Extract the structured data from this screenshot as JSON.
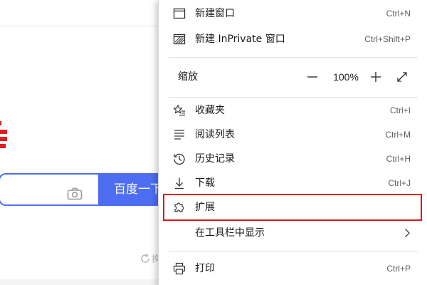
{
  "background": {
    "search_button_label": "百度一下",
    "refresh_text": "换"
  },
  "menu": {
    "items": [
      {
        "id": "new-window",
        "label": "新建窗口",
        "shortcut": "Ctrl+N",
        "icon": "window-icon"
      },
      {
        "id": "new-inprivate",
        "label": "新建 InPrivate 窗口",
        "shortcut": "Ctrl+Shift+P",
        "icon": "inprivate-window-icon"
      },
      {
        "id": "favorites",
        "label": "收藏夹",
        "shortcut": "Ctrl+I",
        "icon": "favorites-star-icon"
      },
      {
        "id": "reading-list",
        "label": "阅读列表",
        "shortcut": "Ctrl+M",
        "icon": "reading-list-icon"
      },
      {
        "id": "history",
        "label": "历史记录",
        "shortcut": "Ctrl+H",
        "icon": "history-icon"
      },
      {
        "id": "downloads",
        "label": "下载",
        "shortcut": "Ctrl+J",
        "icon": "download-icon"
      },
      {
        "id": "extensions",
        "label": "扩展",
        "shortcut": "",
        "icon": "puzzle-piece-icon"
      },
      {
        "id": "show-in-toolbar",
        "label": "在工具栏中显示",
        "shortcut": "",
        "icon": ""
      },
      {
        "id": "print",
        "label": "打印",
        "shortcut": "Ctrl+P",
        "icon": "printer-icon"
      }
    ],
    "zoom": {
      "label": "缩放",
      "value": "100%",
      "minus_icon": "minus-icon",
      "plus_icon": "plus-icon",
      "fullscreen_icon": "fullscreen-icon"
    }
  },
  "colors": {
    "accent_blue": "#4e6ef2",
    "highlight_red": "#e0161b",
    "baidu_red": "#de1f1f"
  }
}
